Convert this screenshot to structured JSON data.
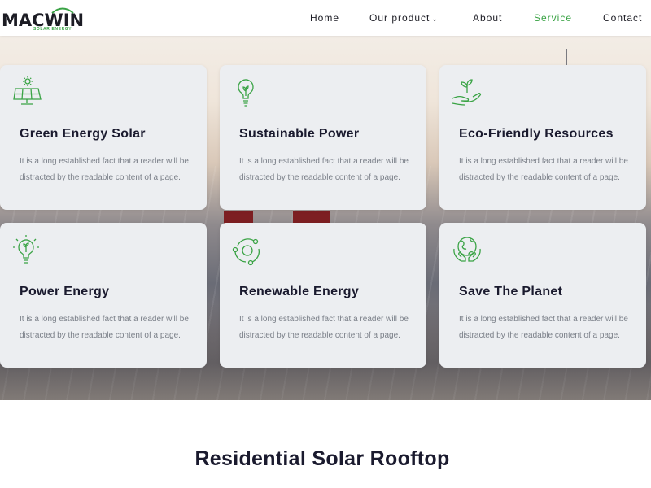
{
  "brand": {
    "name": "MACWIN",
    "tagline": "SOLAR ENERGY",
    "accent_color": "#3aa345"
  },
  "nav": {
    "items": [
      {
        "label": "Home",
        "active": false
      },
      {
        "label": "Our product",
        "active": false,
        "has_dropdown": true
      },
      {
        "label": "About",
        "active": false
      },
      {
        "label": "Service",
        "active": true
      },
      {
        "label": "Contact",
        "active": false
      }
    ],
    "chevron": "⌄"
  },
  "features": [
    {
      "icon": "solar-panel-icon",
      "title": "Green Energy Solar",
      "description": "It is a long established fact that a reader will be distracted by the readable content of a page."
    },
    {
      "icon": "lightbulb-leaf-icon",
      "title": "Sustainable Power",
      "description": "It is a long established fact that a reader will be distracted by the readable content of a page."
    },
    {
      "icon": "hand-plant-icon",
      "title": "Eco-Friendly Resources",
      "description": "It is a long established fact that a reader will be distracted by the readable content of a page."
    },
    {
      "icon": "power-bulb-icon",
      "title": "Power Energy",
      "description": "It is a long established fact that a reader will be distracted by the readable content of a page."
    },
    {
      "icon": "renewable-cycle-icon",
      "title": "Renewable Energy",
      "description": "It is a long established fact that a reader will be distracted by the readable content of a page."
    },
    {
      "icon": "globe-hands-icon",
      "title": "Save The Planet",
      "description": "It is a long established fact that a reader will be distracted by the readable content of a page."
    }
  ],
  "section": {
    "title": "Residential Solar Rooftop"
  }
}
